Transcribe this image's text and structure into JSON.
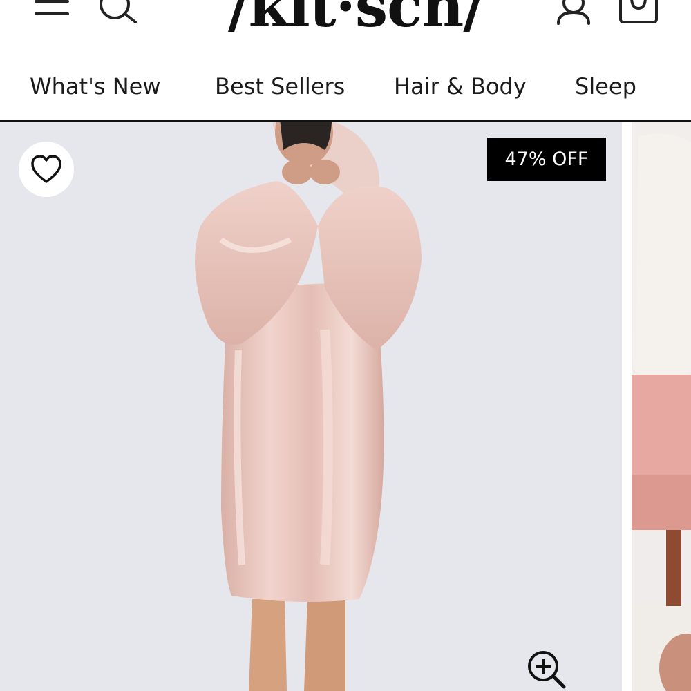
{
  "header": {
    "logo_text": "/kit·sch/",
    "icons": {
      "menu": "hamburger-menu-icon",
      "search": "search-icon",
      "account": "user-account-icon",
      "bag": "shopping-bag-icon"
    }
  },
  "nav": {
    "items": [
      {
        "label": "What's New"
      },
      {
        "label": "Best Sellers"
      },
      {
        "label": "Hair & Body"
      },
      {
        "label": "Sleep"
      }
    ]
  },
  "product": {
    "badge_text": "47% OFF",
    "image_description_colors": {
      "background": "#e6e7ec",
      "garment": "#e8c4bd"
    },
    "icons": {
      "wishlist": "heart-outline-icon",
      "zoom": "zoom-in-icon"
    }
  },
  "colors": {
    "text": "#1a1a1a",
    "badge_bg": "#000000",
    "badge_text": "#ffffff"
  }
}
